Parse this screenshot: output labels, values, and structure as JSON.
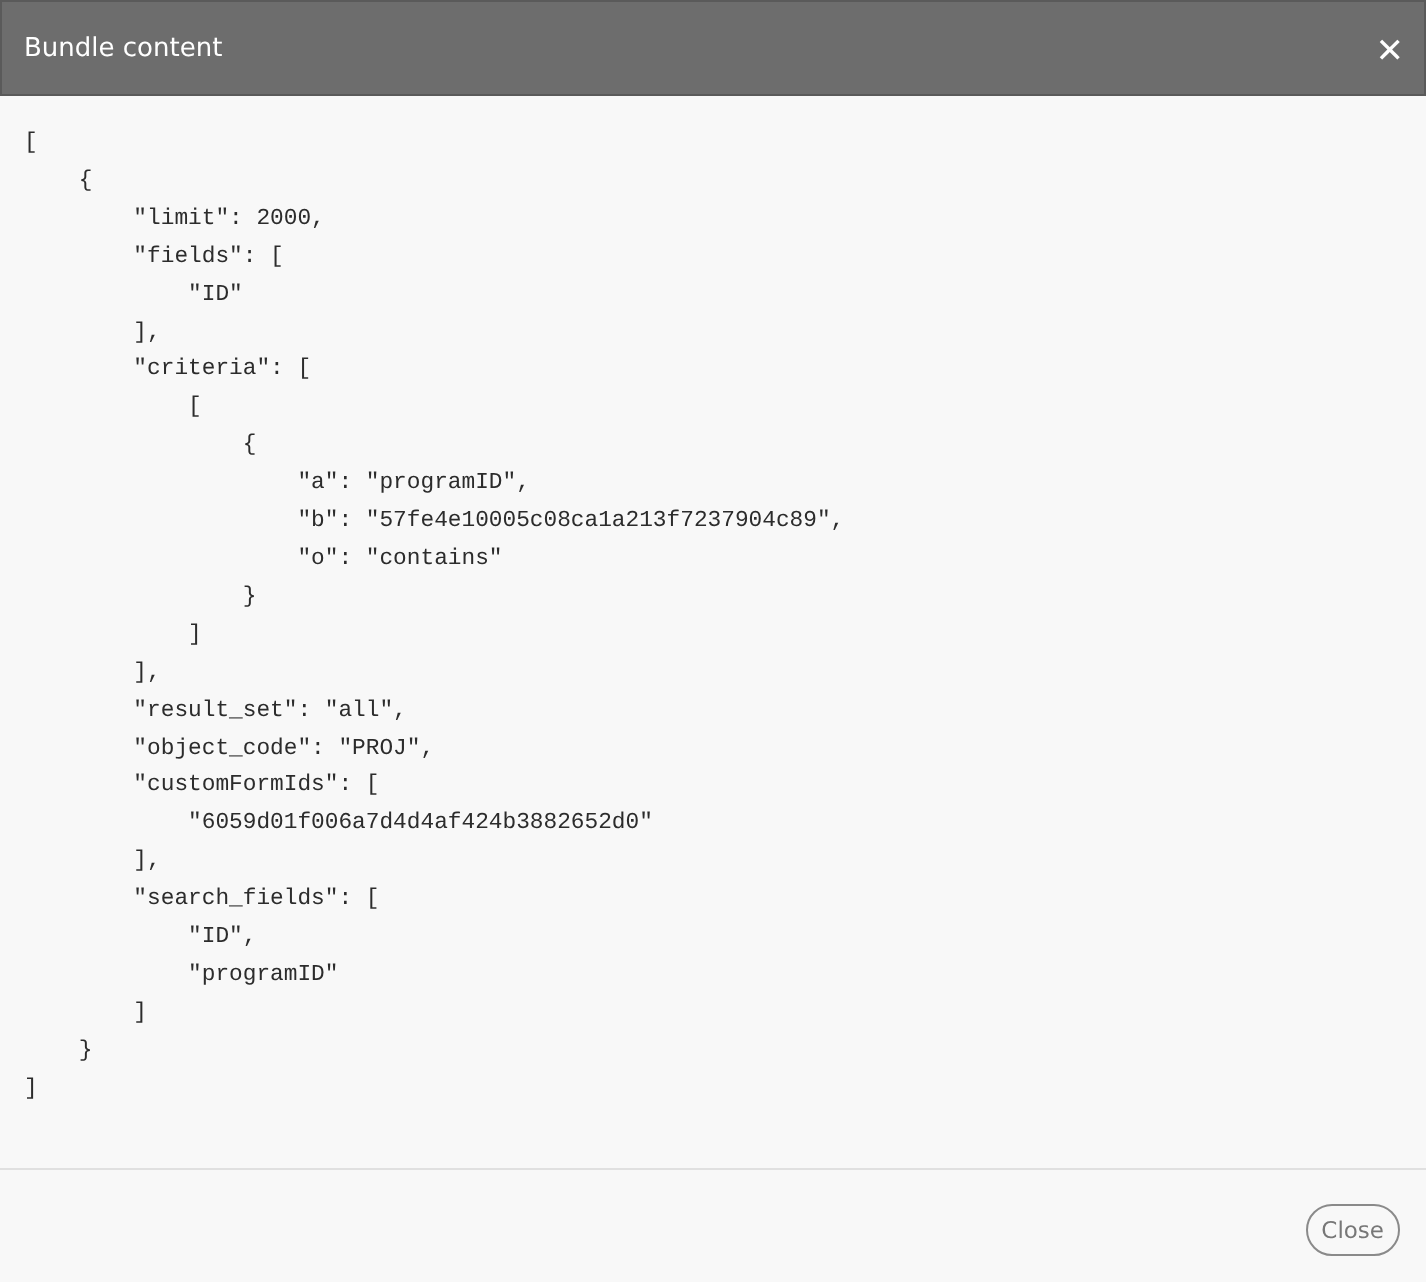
{
  "dialog": {
    "title": "Bundle content",
    "close_icon": "✕",
    "code_lines": [
      "[",
      "    {",
      "        \"limit\": 2000,",
      "        \"fields\": [",
      "            \"ID\"",
      "        ],",
      "        \"criteria\": [",
      "            [",
      "                {",
      "                    \"a\": \"programID\",",
      "                    \"b\": \"57fe4e10005c08ca1a213f7237904c89\",",
      "                    \"o\": \"contains\"",
      "                }",
      "            ]",
      "        ],",
      "        \"result_set\": \"all\",",
      "        \"object_code\": \"PROJ\",",
      "        \"customFormIds\": [",
      "            \"6059d01f006a7d4d4af424b3882652d0\"",
      "        ],",
      "        \"search_fields\": [",
      "            \"ID\",",
      "            \"programID\"",
      "        ]",
      "    }",
      "]"
    ],
    "buttons": [
      "Close"
    ]
  }
}
